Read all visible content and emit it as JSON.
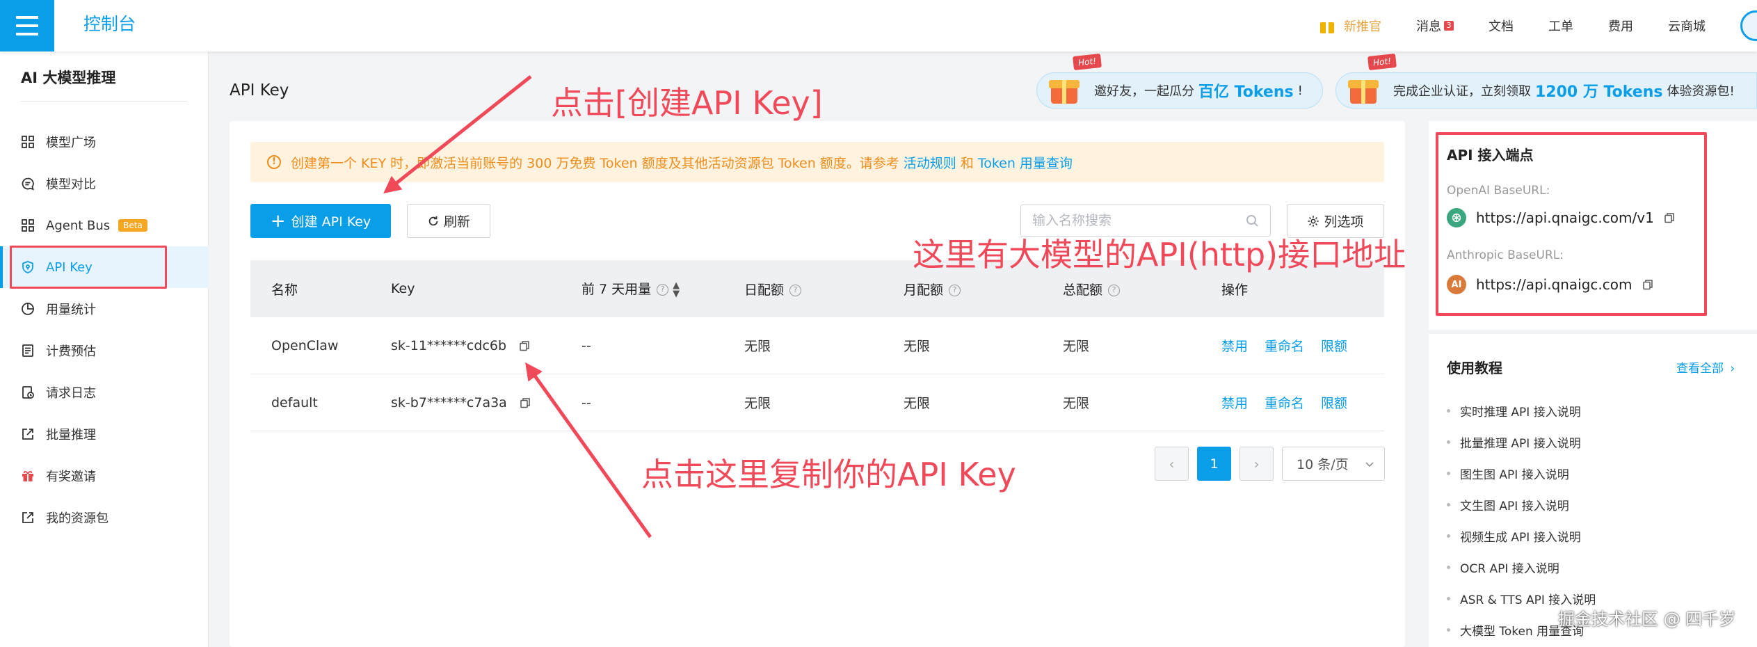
{
  "topbar": {
    "brand": "控制台",
    "nav": {
      "recommend": "新推官",
      "messages": "消息",
      "messages_count": "3",
      "docs": "文档",
      "tickets": "工单",
      "billing": "费用",
      "mall": "云商城"
    }
  },
  "sidebar": {
    "title": "AI 大模型推理",
    "items": [
      {
        "label": "模型广场",
        "icon": "grid-icon"
      },
      {
        "label": "模型对比",
        "icon": "chat-icon"
      },
      {
        "label": "Agent Bus",
        "icon": "grid-icon",
        "tag": "Beta"
      },
      {
        "label": "API Key",
        "icon": "shield-icon",
        "active": true
      },
      {
        "label": "用量统计",
        "icon": "pie-chart-icon"
      },
      {
        "label": "计费预估",
        "icon": "document-icon"
      },
      {
        "label": "请求日志",
        "icon": "clock-icon"
      },
      {
        "label": "批量推理",
        "icon": "export-icon"
      },
      {
        "label": "有奖邀请",
        "icon": "gift-icon"
      },
      {
        "label": "我的资源包",
        "icon": "export-icon"
      }
    ]
  },
  "page": {
    "title": "API Key"
  },
  "promos": [
    {
      "hot": "Hot!",
      "prefix": "邀好友，一起瓜分",
      "emphasis": "百亿 Tokens",
      "suffix": "!"
    },
    {
      "hot": "Hot!",
      "prefix": "完成企业认证，立刻领取",
      "emphasis": "1200 万 Tokens",
      "suffix": "体验资源包!"
    }
  ],
  "notice": {
    "text": "创建第一个 KEY 时，即激活当前账号的 300 万免费 Token 额度及其他活动资源包 Token 额度。请参考",
    "link1": "活动规则",
    "and": "和",
    "link2": "Token 用量查询"
  },
  "toolbar": {
    "create_label": "创建 API Key",
    "refresh_label": "刷新",
    "search_placeholder": "输入名称搜索",
    "columns_label": "列选项"
  },
  "table": {
    "headers": {
      "name": "名称",
      "key": "Key",
      "usage7d": "前 7 天用量",
      "daily": "日配额",
      "monthly": "月配额",
      "total": "总配额",
      "actions": "操作"
    },
    "rows": [
      {
        "name": "OpenClaw",
        "key": "sk-11******cdc6b",
        "usage7d": "--",
        "daily": "无限",
        "monthly": "无限",
        "total": "无限"
      },
      {
        "name": "default",
        "key": "sk-b7******c7a3a",
        "usage7d": "--",
        "daily": "无限",
        "monthly": "无限",
        "total": "无限"
      }
    ],
    "actions": {
      "disable": "禁用",
      "rename": "重命名",
      "limit": "限额"
    }
  },
  "pagination": {
    "current": "1",
    "page_size": "10 条/页"
  },
  "endpoints": {
    "title": "API 接入端点",
    "openai_label": "OpenAI BaseURL:",
    "openai_url": "https://api.qnaigc.com/v1",
    "anthropic_label": "Anthropic BaseURL:",
    "anthropic_url": "https://api.qnaigc.com"
  },
  "tutorials": {
    "title": "使用教程",
    "view_all": "查看全部",
    "items": [
      "实时推理 API 接入说明",
      "批量推理 API 接入说明",
      "图生图 API 接入说明",
      "文生图 API 接入说明",
      "视频生成 API 接入说明",
      "OCR API 接入说明",
      "ASR & TTS API 接入说明",
      "大模型 Token 用量查询"
    ]
  },
  "annotations": {
    "create_hint": "点击[创建API Key]",
    "endpoint_hint": "这里有大模型的API(http)接口地址",
    "copy_hint": "点击这里复制你的API Key"
  },
  "watermark": "掘金技术社区 @ 四千岁",
  "colors": {
    "primary": "#0a9ee8",
    "annotation_red": "#f04a5a",
    "notice_orange": "#f08c1a",
    "notice_bg": "#fff3e0"
  }
}
